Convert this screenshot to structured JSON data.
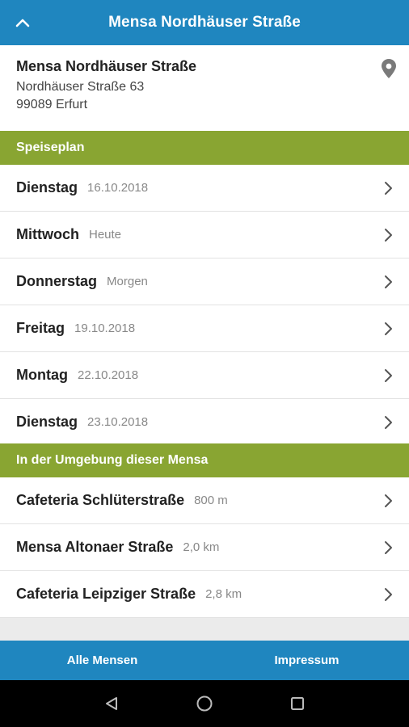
{
  "header": {
    "title": "Mensa Nordhäuser Straße",
    "up_icon": "chevron-up-icon"
  },
  "mensa": {
    "name": "Mensa Nordhäuser Straße",
    "street": "Nordhäuser Straße 63",
    "city": "99089 Erfurt",
    "location_icon": "map-pin-icon"
  },
  "speiseplan": {
    "heading": "Speiseplan",
    "days": [
      {
        "day": "Dienstag",
        "date": "16.10.2018"
      },
      {
        "day": "Mittwoch",
        "date": "Heute"
      },
      {
        "day": "Donnerstag",
        "date": "Morgen"
      },
      {
        "day": "Freitag",
        "date": "19.10.2018"
      },
      {
        "day": "Montag",
        "date": "22.10.2018"
      },
      {
        "day": "Dienstag",
        "date": "23.10.2018"
      }
    ]
  },
  "nearby": {
    "heading": "In der Umgebung dieser Mensa",
    "places": [
      {
        "name": "Cafeteria Schlüterstraße",
        "distance": "800 m"
      },
      {
        "name": "Mensa Altonaer Straße",
        "distance": "2,0 km"
      },
      {
        "name": "Cafeteria Leipziger Straße",
        "distance": "2,8 km"
      }
    ]
  },
  "bottom": {
    "all_label": "Alle Mensen",
    "impressum_label": "Impressum"
  },
  "colors": {
    "primary": "#1f86bf",
    "section": "#89a532"
  }
}
